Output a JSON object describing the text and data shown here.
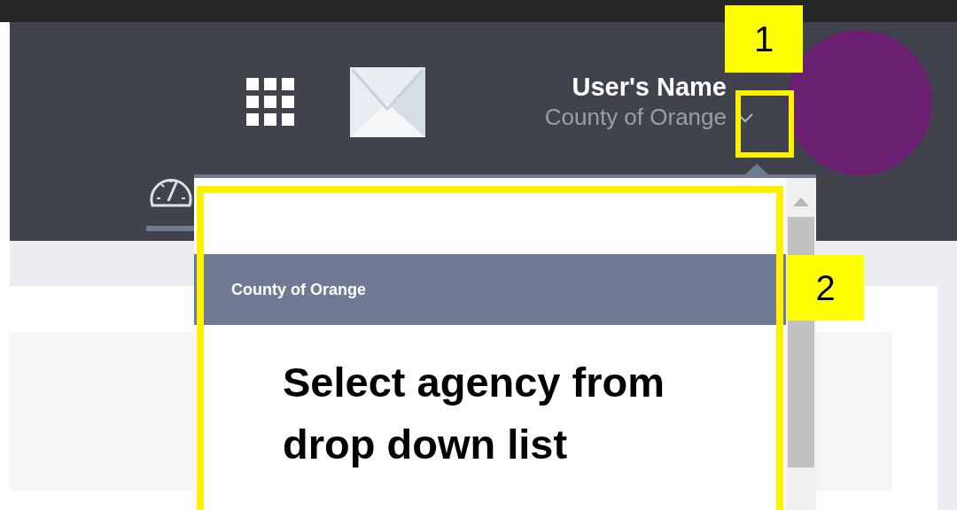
{
  "header": {
    "user_name": "User's Name",
    "agency": "County of Orange",
    "nav_tab": {
      "selected": true
    }
  },
  "dropdown": {
    "items": [
      {
        "label": "County of Orange",
        "selected": true
      }
    ]
  },
  "annotations": [
    {
      "label": "1",
      "kind": "chevron"
    },
    {
      "label": "2",
      "kind": "dropdown"
    }
  ],
  "callout": "Select agency from drop down list"
}
